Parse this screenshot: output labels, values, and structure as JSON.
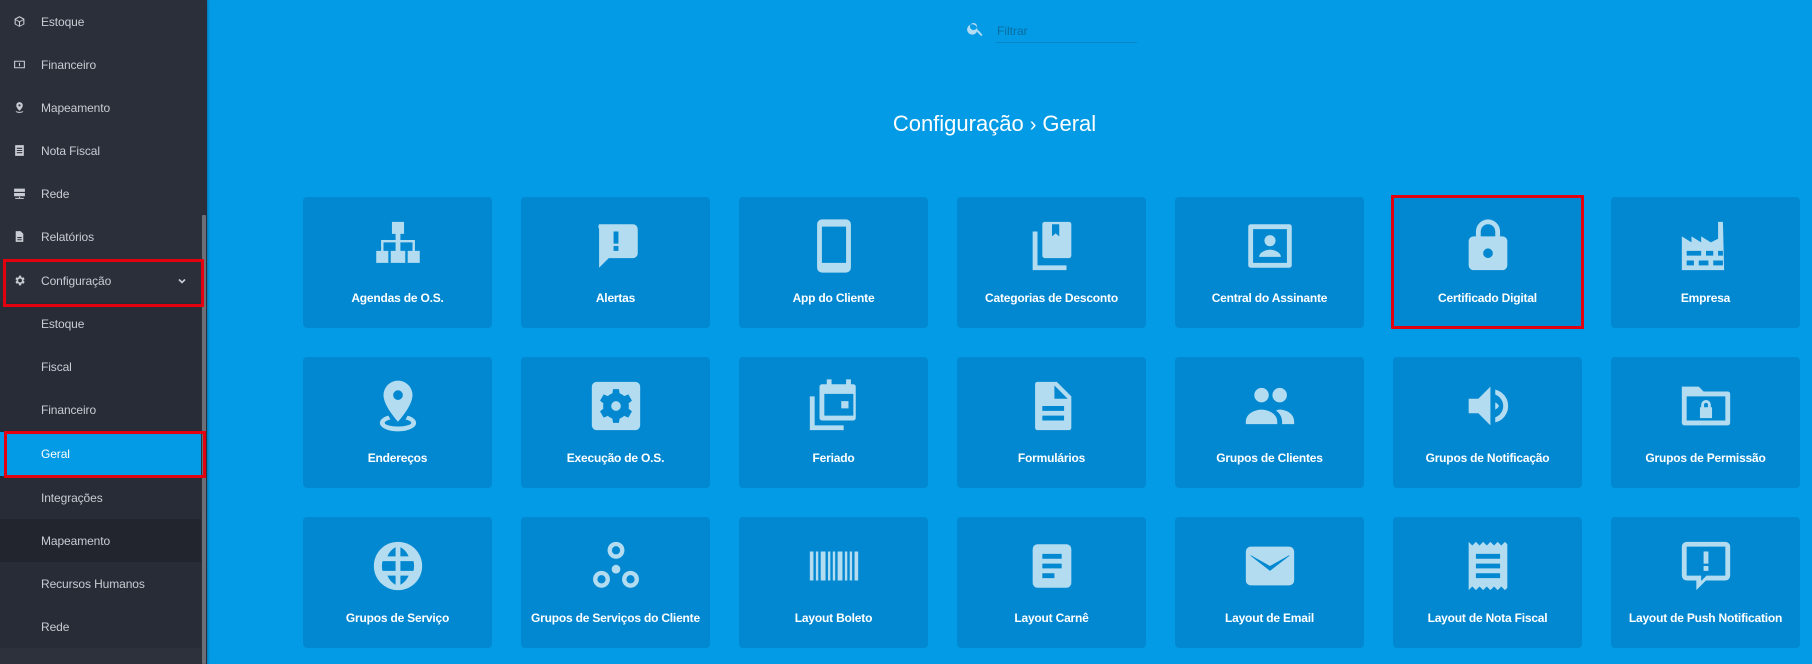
{
  "sidebar": {
    "items": [
      {
        "label": "Estoque",
        "icon": "cube-icon"
      },
      {
        "label": "Financeiro",
        "icon": "money-icon"
      },
      {
        "label": "Mapeamento",
        "icon": "location-pin-icon"
      },
      {
        "label": "Nota Fiscal",
        "icon": "receipt-icon"
      },
      {
        "label": "Rede",
        "icon": "server-icon"
      },
      {
        "label": "Relatórios",
        "icon": "document-icon"
      },
      {
        "label": "Configuração",
        "icon": "gear-icon",
        "expanded": true
      }
    ],
    "sub_items": [
      {
        "label": "Estoque"
      },
      {
        "label": "Fiscal"
      },
      {
        "label": "Financeiro"
      },
      {
        "label": "Geral",
        "active": true
      },
      {
        "label": "Integrações"
      },
      {
        "label": "Mapeamento",
        "hover": true
      },
      {
        "label": "Recursos Humanos"
      },
      {
        "label": "Rede"
      }
    ]
  },
  "search": {
    "placeholder": "Filtrar",
    "value": ""
  },
  "header": {
    "breadcrumb_parent": "Configuração",
    "breadcrumb_separator": "›",
    "breadcrumb_current": "Geral"
  },
  "tiles": [
    {
      "label": "Agendas de O.S.",
      "icon": "sitemap-icon"
    },
    {
      "label": "Alertas",
      "icon": "alert-message-icon"
    },
    {
      "label": "App do Cliente",
      "icon": "smartphone-icon"
    },
    {
      "label": "Categorias de Desconto",
      "icon": "library-books-icon"
    },
    {
      "label": "Central do Assinante",
      "icon": "contact-portrait-icon"
    },
    {
      "label": "Certificado Digital",
      "icon": "lock-icon",
      "selected": true
    },
    {
      "label": "Empresa",
      "icon": "factory-icon"
    },
    {
      "label": "Endereços",
      "icon": "location-pin-icon"
    },
    {
      "label": "Execução de O.S.",
      "icon": "settings-box-icon"
    },
    {
      "label": "Feriado",
      "icon": "calendar-multiple-icon"
    },
    {
      "label": "Formulários",
      "icon": "file-document-icon"
    },
    {
      "label": "Grupos de Clientes",
      "icon": "people-icon"
    },
    {
      "label": "Grupos de Notificação",
      "icon": "volume-icon"
    },
    {
      "label": "Grupos de Permissão",
      "icon": "folder-lock-icon"
    },
    {
      "label": "Grupos de Serviço",
      "icon": "globe-icon"
    },
    {
      "label": "Grupos de Serviços do Cliente",
      "icon": "bubble-chart-icon"
    },
    {
      "label": "Layout Boleto",
      "icon": "barcode-icon"
    },
    {
      "label": "Layout Carnê",
      "icon": "note-text-icon"
    },
    {
      "label": "Layout de Email",
      "icon": "email-icon"
    },
    {
      "label": "Layout de Nota Fiscal",
      "icon": "receipt-long-icon"
    },
    {
      "label": "Layout de Push Notification",
      "icon": "message-alert-outline-icon"
    }
  ],
  "colors": {
    "main_bg": "#039be5",
    "tile_bg": "#0288d1",
    "tile_icon": "#b3dcf0",
    "sidebar_bg": "#2b2f3a",
    "active_item": "#039be5",
    "highlight_border": "#e3000f"
  }
}
